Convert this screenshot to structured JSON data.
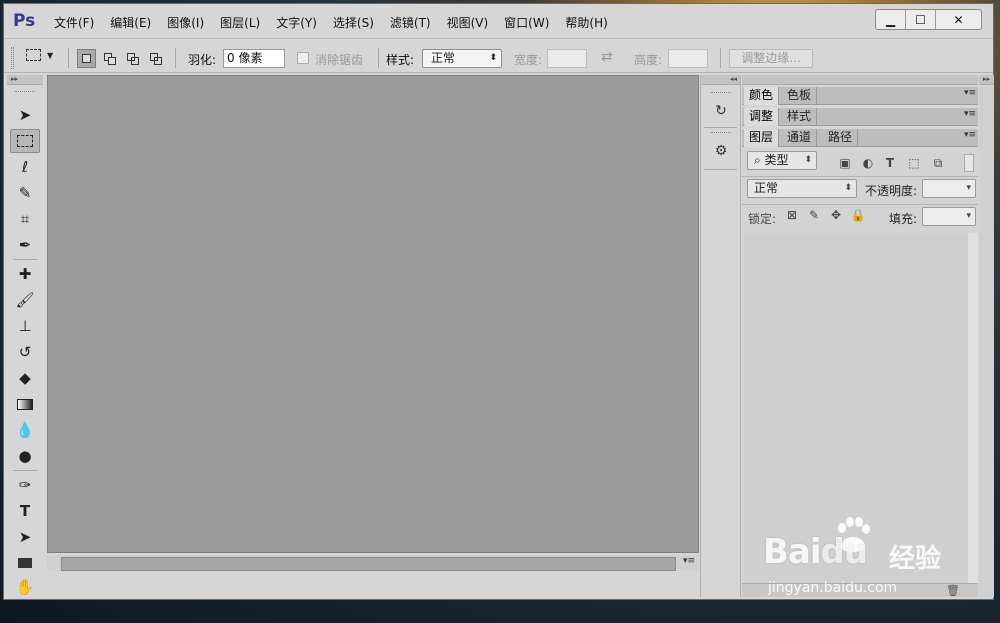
{
  "app": {
    "logo": "Ps"
  },
  "menu": [
    "文件(F)",
    "编辑(E)",
    "图像(I)",
    "图层(L)",
    "文字(Y)",
    "选择(S)",
    "滤镜(T)",
    "视图(V)",
    "窗口(W)",
    "帮助(H)"
  ],
  "window_controls": {
    "minimize": "▁",
    "maximize": "☐",
    "close": "✕"
  },
  "options": {
    "feather_label": "羽化:",
    "feather_value": "0 像素",
    "anti_alias": "消除锯齿",
    "style_label": "样式:",
    "style_value": "正常",
    "width_label": "宽度:",
    "height_label": "高度:",
    "refine_edge": "调整边缘..."
  },
  "tools": [
    "move-tool",
    "marquee-tool",
    "lasso-tool",
    "quick-select-tool",
    "crop-tool",
    "eyedropper-tool",
    "healing-brush-tool",
    "brush-tool",
    "clone-stamp-tool",
    "history-brush-tool",
    "eraser-tool",
    "gradient-tool",
    "blur-tool",
    "dodge-tool",
    "pen-tool",
    "type-tool",
    "path-select-tool",
    "rectangle-tool",
    "hand-tool"
  ],
  "panels": {
    "group1": [
      "颜色",
      "色板"
    ],
    "group2": [
      "调整",
      "样式"
    ],
    "group3": [
      "图层",
      "通道",
      "路径"
    ]
  },
  "layers": {
    "filter_kind": "类型",
    "blend_mode": "正常",
    "opacity_label": "不透明度:",
    "lock_label": "锁定:",
    "fill_label": "填充:"
  },
  "watermark": {
    "text": "Bai",
    "text2": "du",
    "cn": "经验",
    "url": "jingyan.baidu.com"
  },
  "colors": {
    "accent": "#343a8e",
    "canvas": "#9b9b9b",
    "panel": "#d6d6d6"
  }
}
